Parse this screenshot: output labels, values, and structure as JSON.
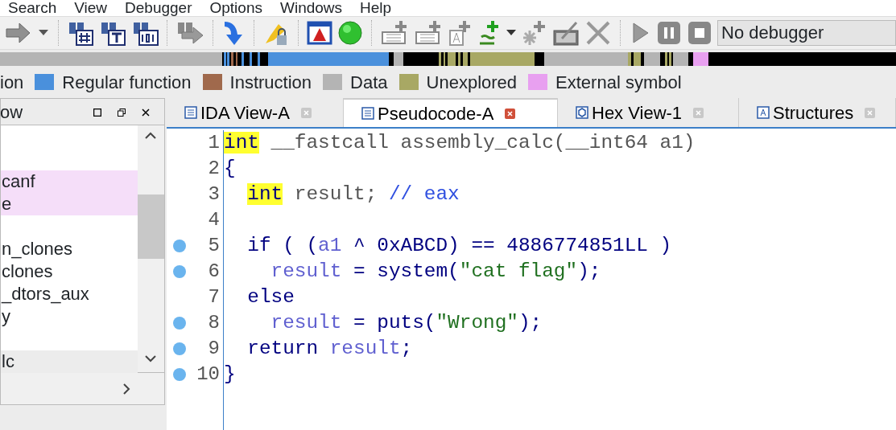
{
  "menu": [
    "Search",
    "View",
    "Debugger",
    "Options",
    "Windows",
    "Help"
  ],
  "debugger_select": {
    "value": "No debugger"
  },
  "legend": [
    {
      "label": "ion"
    },
    {
      "label": "Regular function",
      "color": "#4a90dc"
    },
    {
      "label": "Instruction",
      "color": "#a0694c"
    },
    {
      "label": "Data",
      "color": "#b4b4b4"
    },
    {
      "label": "Unexplored",
      "color": "#a8a864"
    },
    {
      "label": "External symbol",
      "color": "#e8a0f0"
    }
  ],
  "side_panel": {
    "title": "ow",
    "items": [
      {
        "kind": "blank"
      },
      {
        "kind": "blank"
      },
      {
        "label": "canf",
        "kind": "external",
        "selected": false
      },
      {
        "label": "e",
        "kind": "external",
        "selected": false
      },
      {
        "kind": "blank"
      },
      {
        "label": "n_clones",
        "kind": "plain",
        "selected": false
      },
      {
        "label": "clones",
        "kind": "plain",
        "selected": false
      },
      {
        "label": "_dtors_aux",
        "kind": "plain",
        "selected": false
      },
      {
        "label": "y",
        "kind": "plain",
        "selected": false
      },
      {
        "kind": "blank"
      },
      {
        "label": "lc",
        "kind": "plain",
        "selected": true
      }
    ]
  },
  "tabs": [
    {
      "label": "IDA View-A",
      "selected": false
    },
    {
      "label": "Pseudocode-A",
      "selected": true
    },
    {
      "label": "Hex View-1",
      "selected": false
    },
    {
      "label": "Structures",
      "selected": false
    }
  ],
  "code": [
    {
      "number": "1",
      "breakpoint": false,
      "kind": "top",
      "tokens": [
        {
          "kind": "highlight",
          "text": "int"
        },
        {
          "kind": "plain",
          "text": " __fastcall assembly_calc(__int64 a1)"
        }
      ]
    },
    {
      "number": "2",
      "breakpoint": false,
      "kind": "top",
      "tokens": [
        {
          "kind": "keyword",
          "text": "{"
        }
      ]
    },
    {
      "number": "3",
      "breakpoint": false,
      "kind": "body",
      "tokens": [
        {
          "kind": "highlight",
          "text": "int"
        },
        {
          "kind": "plain",
          "text": " result; "
        },
        {
          "kind": "comment",
          "text": "// eax"
        }
      ]
    },
    {
      "number": "4",
      "breakpoint": false,
      "kind": "top"
    },
    {
      "number": "5",
      "breakpoint": true,
      "kind": "body",
      "tokens": [
        {
          "kind": "keyword",
          "text": "if ( ("
        },
        {
          "kind": "variable",
          "text": "a1"
        },
        {
          "kind": "keyword",
          "text": " ^ 0xABCD) == 4886774851LL )"
        }
      ]
    },
    {
      "number": "6",
      "breakpoint": true,
      "kind": "nested",
      "tokens": [
        {
          "kind": "variable",
          "text": "result"
        },
        {
          "kind": "keyword",
          "text": " = system("
        },
        {
          "kind": "string",
          "text": "\"cat flag\""
        },
        {
          "kind": "keyword",
          "text": ");"
        }
      ]
    },
    {
      "number": "7",
      "breakpoint": false,
      "kind": "body",
      "tokens": [
        {
          "kind": "keyword",
          "text": "else"
        }
      ]
    },
    {
      "number": "8",
      "breakpoint": true,
      "kind": "nested",
      "tokens": [
        {
          "kind": "variable",
          "text": "result"
        },
        {
          "kind": "keyword",
          "text": " = puts("
        },
        {
          "kind": "string",
          "text": "\"Wrong\""
        },
        {
          "kind": "keyword",
          "text": ");"
        }
      ]
    },
    {
      "number": "9",
      "breakpoint": true,
      "kind": "body",
      "tokens": [
        {
          "kind": "keyword",
          "text": "return "
        },
        {
          "kind": "variable",
          "text": "result"
        },
        {
          "kind": "keyword",
          "text": ";"
        }
      ]
    },
    {
      "number": "10",
      "breakpoint": true,
      "kind": "top",
      "tokens": [
        {
          "kind": "keyword",
          "text": "}"
        }
      ]
    }
  ]
}
